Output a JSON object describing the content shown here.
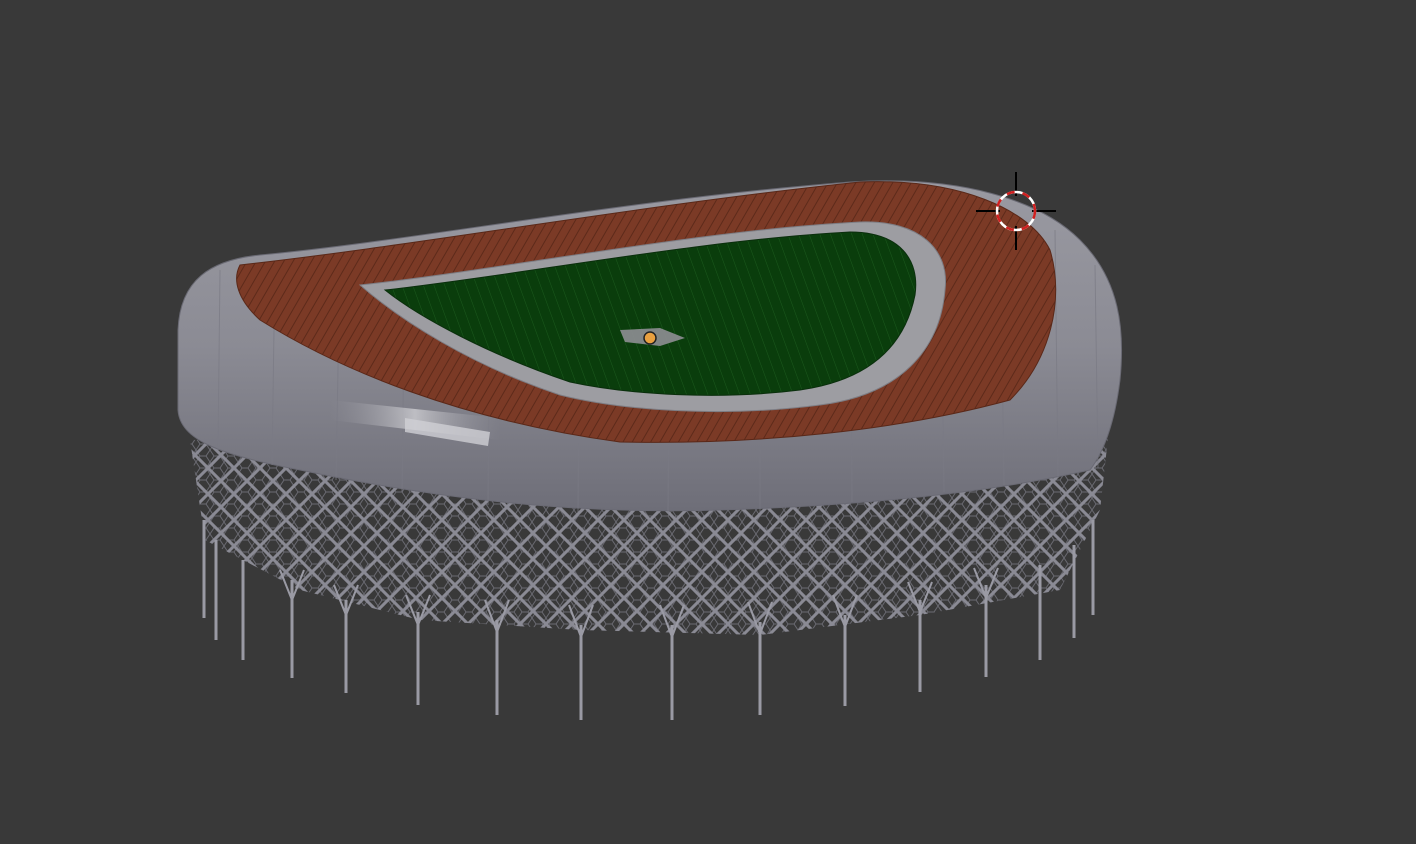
{
  "viewport": {
    "background": "#393939"
  },
  "model": {
    "roof_color": "#8d8d95",
    "roof_highlight": "#c8c8cc",
    "seating_color": "#7a3a26",
    "inner_ring_color": "#9d9da2",
    "field_color": "#0a3d0c",
    "facade_color": "#8a8a94",
    "column_color": "#9a9aa4",
    "origin_color": "#e8a040"
  },
  "cursor": {
    "icon": "3d-cursor-icon",
    "ring_red": "#d02020",
    "ring_white": "#ffffff"
  }
}
